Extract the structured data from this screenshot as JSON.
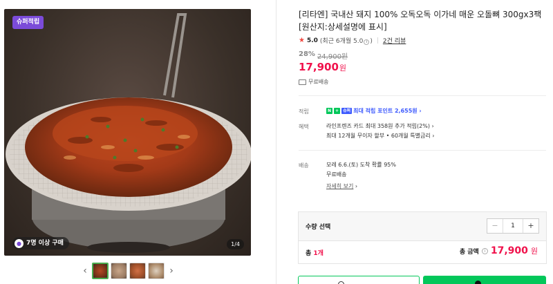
{
  "gallery": {
    "badge": "슈퍼적립",
    "buyers": "7명 이상 구매",
    "buyers_icon": "bag-icon",
    "counter": "1/4",
    "prev": "‹",
    "next": "›"
  },
  "product": {
    "title": "[리타엔] 국내산 돼지 100% 오독오독 이가네 매운 오돌뼈 300gx3팩 [원산지:상세설명에 표시]",
    "rating": {
      "star": "★",
      "score": "5.0",
      "recent": "(최근 6개월 5.0",
      "recent_close": ")",
      "reviews": "2건 리뷰"
    },
    "discount_pct": "28%",
    "original_price": "24,900원",
    "price": "17,900",
    "price_unit": "원",
    "shipping": "무료배송"
  },
  "benefits": {
    "points_label": "적립",
    "badge_n": "N",
    "badge_plus": "+",
    "badge_s": "슈퍼",
    "points_text": "최대 적립 포인트 2,655원 ›",
    "card_label": "혜택",
    "card_line1": "라인프렌즈 카드 최대 358원 추가 적립(2%) ›",
    "card_line2": "최대 12개월 무이자 할부 • 60개월 특별금리 ›"
  },
  "delivery": {
    "label": "배송",
    "line1": "모레 6.6.(토) 도착 확률 95%",
    "line2": "무료배송",
    "more": "자세히 보기",
    "more_arrow": "›"
  },
  "order": {
    "qty_label": "수량 선택",
    "minus": "−",
    "qty": "1",
    "plus": "+",
    "total_prefix": "총 ",
    "total_count": "1개",
    "total_label": "총 금액",
    "info": "i",
    "total_amount": "17,900",
    "total_unit": "원"
  },
  "colors": {
    "accent_red": "#f0114b",
    "naver_green": "#03c75a",
    "badge_purple": "#7b4bd9"
  }
}
